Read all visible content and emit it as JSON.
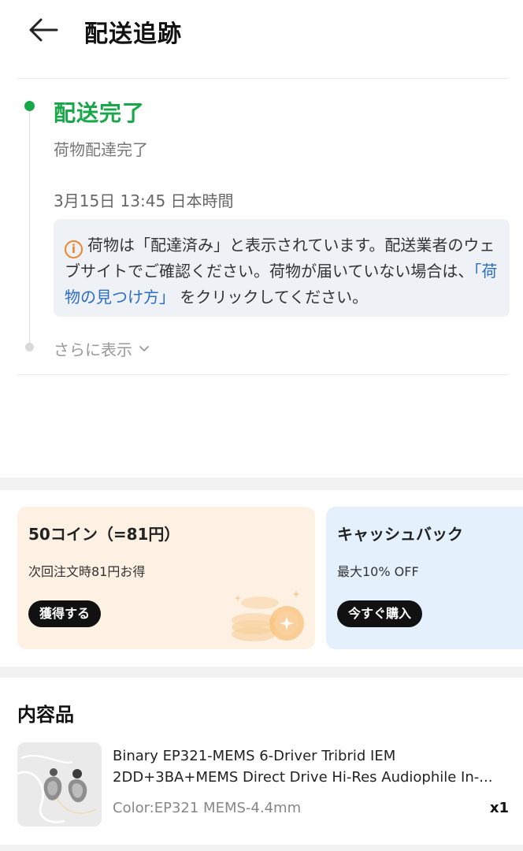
{
  "header": {
    "back_icon": "arrow-left-icon",
    "title": "配送追跡"
  },
  "tracking": {
    "status_title": "配送完了",
    "status_subtitle": "荷物配達完了",
    "timestamp": "3月15日 13:45 日本時間",
    "notice": {
      "icon": "info-icon",
      "text_before": "荷物は「配達済み」と表示されています。配送業者のウェブサイトでご確認ください。荷物が届いていない場合は、",
      "link_text": "「荷物の見つけ方」",
      "text_after": "をクリックしてください。"
    },
    "show_more_label": "さらに表示",
    "status_color": "#18a84a"
  },
  "promos": {
    "coins": {
      "title": "50コイン（=81円）",
      "subtitle": "次回注文時81円お得",
      "button_label": "獲得する",
      "background": "#fdf1e4"
    },
    "cashback": {
      "title": "キャッシュバック",
      "subtitle": "最大10% OFF",
      "button_label": "今すぐ購入",
      "background": "#e4f1fc"
    }
  },
  "items": {
    "section_title": "内容品",
    "products": [
      {
        "name_line1": "Binary EP321-MEMS 6-Driver Tribrid IEM",
        "name_line2": "2DD+3BA+MEMS Direct Drive Hi-Res Audiophile In-...",
        "variant": "Color:EP321 MEMS-4.4mm",
        "quantity": "x1"
      }
    ]
  }
}
